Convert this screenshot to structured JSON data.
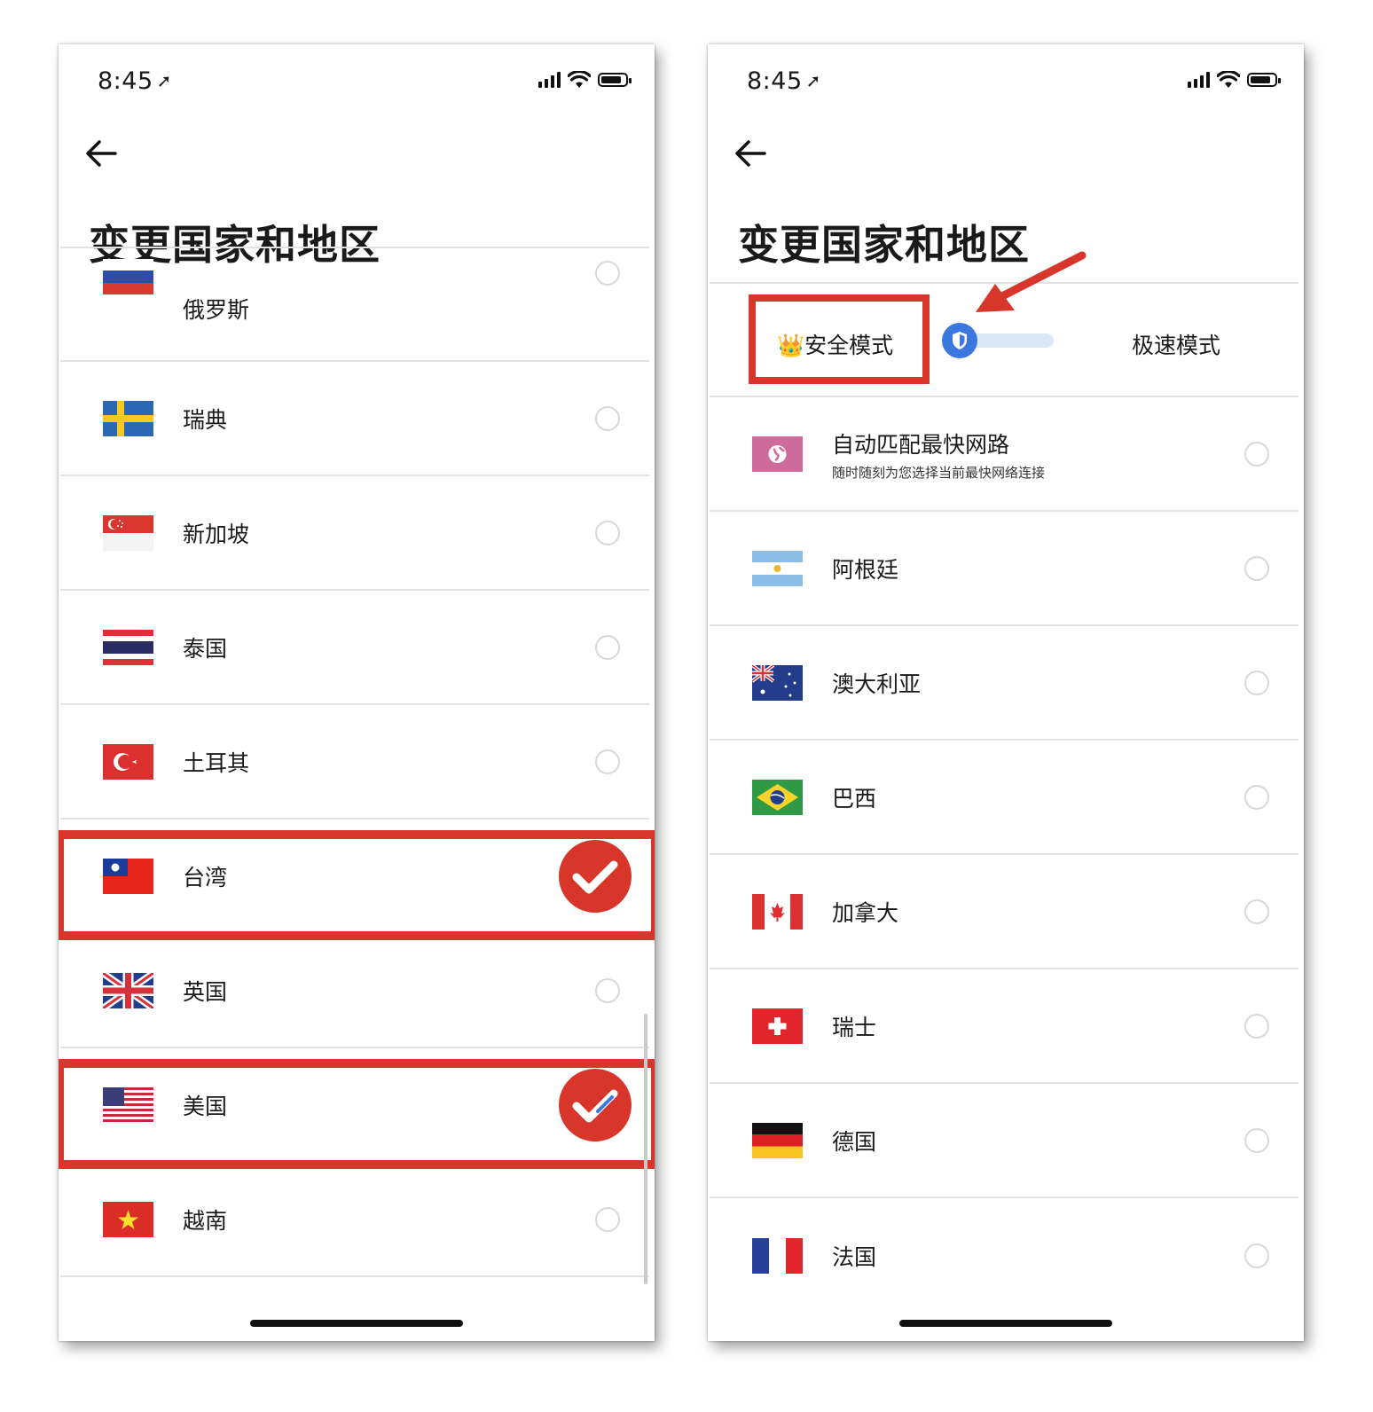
{
  "status_bar": {
    "time": "8:45"
  },
  "left_screen": {
    "title": "变更国家和地区",
    "countries": [
      {
        "name": "俄罗斯",
        "flag": "russia-flag",
        "selected": false
      },
      {
        "name": "瑞典",
        "flag": "sweden-flag",
        "selected": false
      },
      {
        "name": "新加坡",
        "flag": "singapore-flag",
        "selected": false
      },
      {
        "name": "泰国",
        "flag": "thailand-flag",
        "selected": false
      },
      {
        "name": "土耳其",
        "flag": "turkey-flag",
        "selected": false
      },
      {
        "name": "台湾",
        "flag": "taiwan-flag",
        "selected": true
      },
      {
        "name": "英国",
        "flag": "uk-flag",
        "selected": false
      },
      {
        "name": "美国",
        "flag": "usa-flag",
        "selected": true
      },
      {
        "name": "越南",
        "flag": "vietnam-flag",
        "selected": false
      }
    ]
  },
  "right_screen": {
    "title": "变更国家和地区",
    "mode_toggle": {
      "safe_mode_label": "安全模式",
      "fast_mode_label": "极速模式",
      "crown_icon": "👑",
      "active": "safe"
    },
    "auto_option": {
      "title": "自动匹配最快网路",
      "subtitle": "随时随刻为您选择当前最快网络连接",
      "icon": "globe-icon"
    },
    "countries": [
      {
        "name": "阿根廷",
        "flag": "argentina-flag"
      },
      {
        "name": "澳大利亚",
        "flag": "australia-flag"
      },
      {
        "name": "巴西",
        "flag": "brazil-flag"
      },
      {
        "name": "加拿大",
        "flag": "canada-flag"
      },
      {
        "name": "瑞士",
        "flag": "switzerland-flag"
      },
      {
        "name": "德国",
        "flag": "germany-flag"
      },
      {
        "name": "法国",
        "flag": "france-flag"
      }
    ]
  },
  "colors": {
    "annotation_red": "#d8362a",
    "toggle_blue": "#3a78df",
    "divider": "#e2e2e2",
    "radio_border": "#d8d8d8"
  }
}
